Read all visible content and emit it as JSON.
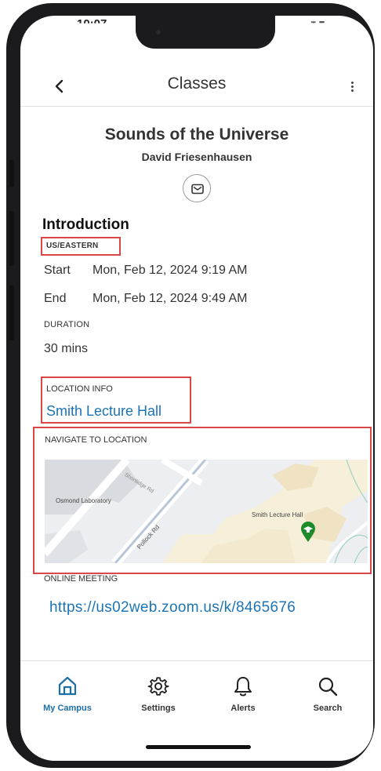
{
  "status_bar": {
    "time": "10:07",
    "indicators": "... ▾ ■"
  },
  "app_bar": {
    "title": "Classes",
    "back_icon": "chevron-left-icon",
    "more_icon": "more-vertical-icon"
  },
  "class_info": {
    "title": "Sounds of the Universe",
    "instructor": "David Friesenhausen",
    "mail_icon": "mail-icon"
  },
  "session": {
    "heading": "Introduction",
    "timezone": "US/EASTERN",
    "start_label": "Start",
    "start_value": "Mon, Feb 12, 2024 9:19 AM",
    "end_label": "End",
    "end_value": "Mon, Feb 12, 2024 9:49 AM",
    "duration_label": "DURATION",
    "duration_value": "30 mins"
  },
  "location": {
    "label": "LOCATION INFO",
    "name": "Smith Lecture Hall",
    "navigate_label": "NAVIGATE TO LOCATION",
    "map": {
      "place_label_1": "Osmond Laboratory",
      "road_label_1": "Pollock Rd",
      "road_label_2": "Shortlidge Rd",
      "pin_label": "Smith Lecture Hall",
      "pin_color": "#1e8a2a"
    }
  },
  "online": {
    "label": "ONLINE MEETING",
    "url": "https://us02web.zoom.us/k/8465676"
  },
  "tabs": [
    {
      "label": "My Campus",
      "icon": "home-icon",
      "active": true
    },
    {
      "label": "Settings",
      "icon": "gear-icon",
      "active": false
    },
    {
      "label": "Alerts",
      "icon": "bell-icon",
      "active": false
    },
    {
      "label": "Search",
      "icon": "search-icon",
      "active": false
    }
  ],
  "colors": {
    "accent": "#1c74b5",
    "highlight_border": "#d84848",
    "active_tab": "#1c6fa8"
  }
}
